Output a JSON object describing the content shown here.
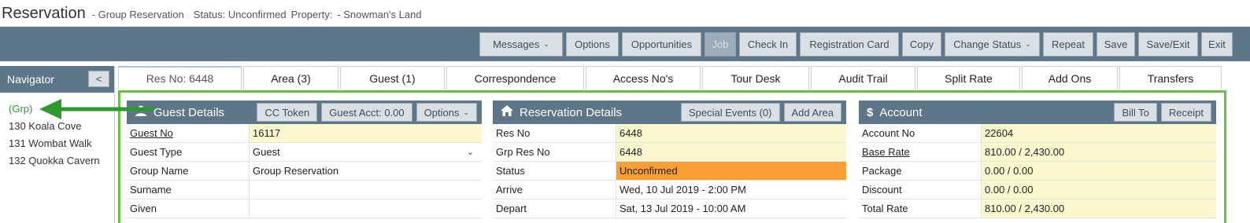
{
  "title": {
    "main": "Reservation",
    "type": "- Group Reservation",
    "status": "Status: Unconfirmed",
    "property_label": "Property:",
    "property": "- Snowman's Land"
  },
  "toolbar": {
    "messages": "Messages",
    "options": "Options",
    "opportunities": "Opportunities",
    "job": "Job",
    "check_in": "Check In",
    "registration_card": "Registration Card",
    "copy": "Copy",
    "change_status": "Change Status",
    "repeat": "Repeat",
    "save": "Save",
    "save_exit": "Save/Exit",
    "exit": "Exit"
  },
  "navigator": {
    "title": "Navigator",
    "collapse": "<",
    "items": [
      "(Grp)",
      "130 Koala Cove",
      "131 Wombat Walk",
      "132 Quokka Cavern"
    ]
  },
  "tabs": [
    "Res No: 6448",
    "Area (3)",
    "Guest (1)",
    "Correspondence",
    "Access No's",
    "Tour Desk",
    "Audit Trail",
    "Split Rate",
    "Add Ons",
    "Transfers"
  ],
  "guest_details": {
    "title": "Guest Details",
    "cc_token": "CC Token",
    "guest_acct": "Guest Acct: 0.00",
    "options": "Options",
    "rows": [
      {
        "label": "Guest No",
        "value": "16117"
      },
      {
        "label": "Guest Type",
        "value": "Guest"
      },
      {
        "label": "Group Name",
        "value": "Group Reservation"
      },
      {
        "label": "Surname",
        "value": ""
      },
      {
        "label": "Given",
        "value": ""
      }
    ]
  },
  "reservation_details": {
    "title": "Reservation Details",
    "special_events": "Special Events (0)",
    "add_area": "Add Area",
    "rows": [
      {
        "label": "Res No",
        "value": "6448"
      },
      {
        "label": "Grp Res No",
        "value": "6448"
      },
      {
        "label": "Status",
        "value": "Unconfirmed"
      },
      {
        "label": "Arrive",
        "value": "Wed, 10 Jul 2019 - 2:00 PM"
      },
      {
        "label": "Depart",
        "value": "Sat, 13 Jul 2019 - 10:00 AM"
      }
    ]
  },
  "account": {
    "title": "Account",
    "bill_to": "Bill To",
    "receipt": "Receipt",
    "rows": [
      {
        "label": "Account No",
        "value": "22604"
      },
      {
        "label": "Base Rate",
        "value": "810.00 / 2,430.00"
      },
      {
        "label": "Package",
        "value": "0.00 / 0.00"
      },
      {
        "label": "Discount",
        "value": "0.00 / 0.00"
      },
      {
        "label": "Total Rate",
        "value": "810.00 / 2,430.00"
      }
    ]
  },
  "colors": {
    "header": "#5d7788",
    "highlight_frame": "#6cc04a",
    "arrow": "#2e9a2e",
    "status_unconfirmed": "#fb9e33",
    "field_bg": "#fdf7cf"
  },
  "icons": {
    "guest": "person-icon",
    "reservation": "home-icon",
    "account": "dollar-icon"
  }
}
